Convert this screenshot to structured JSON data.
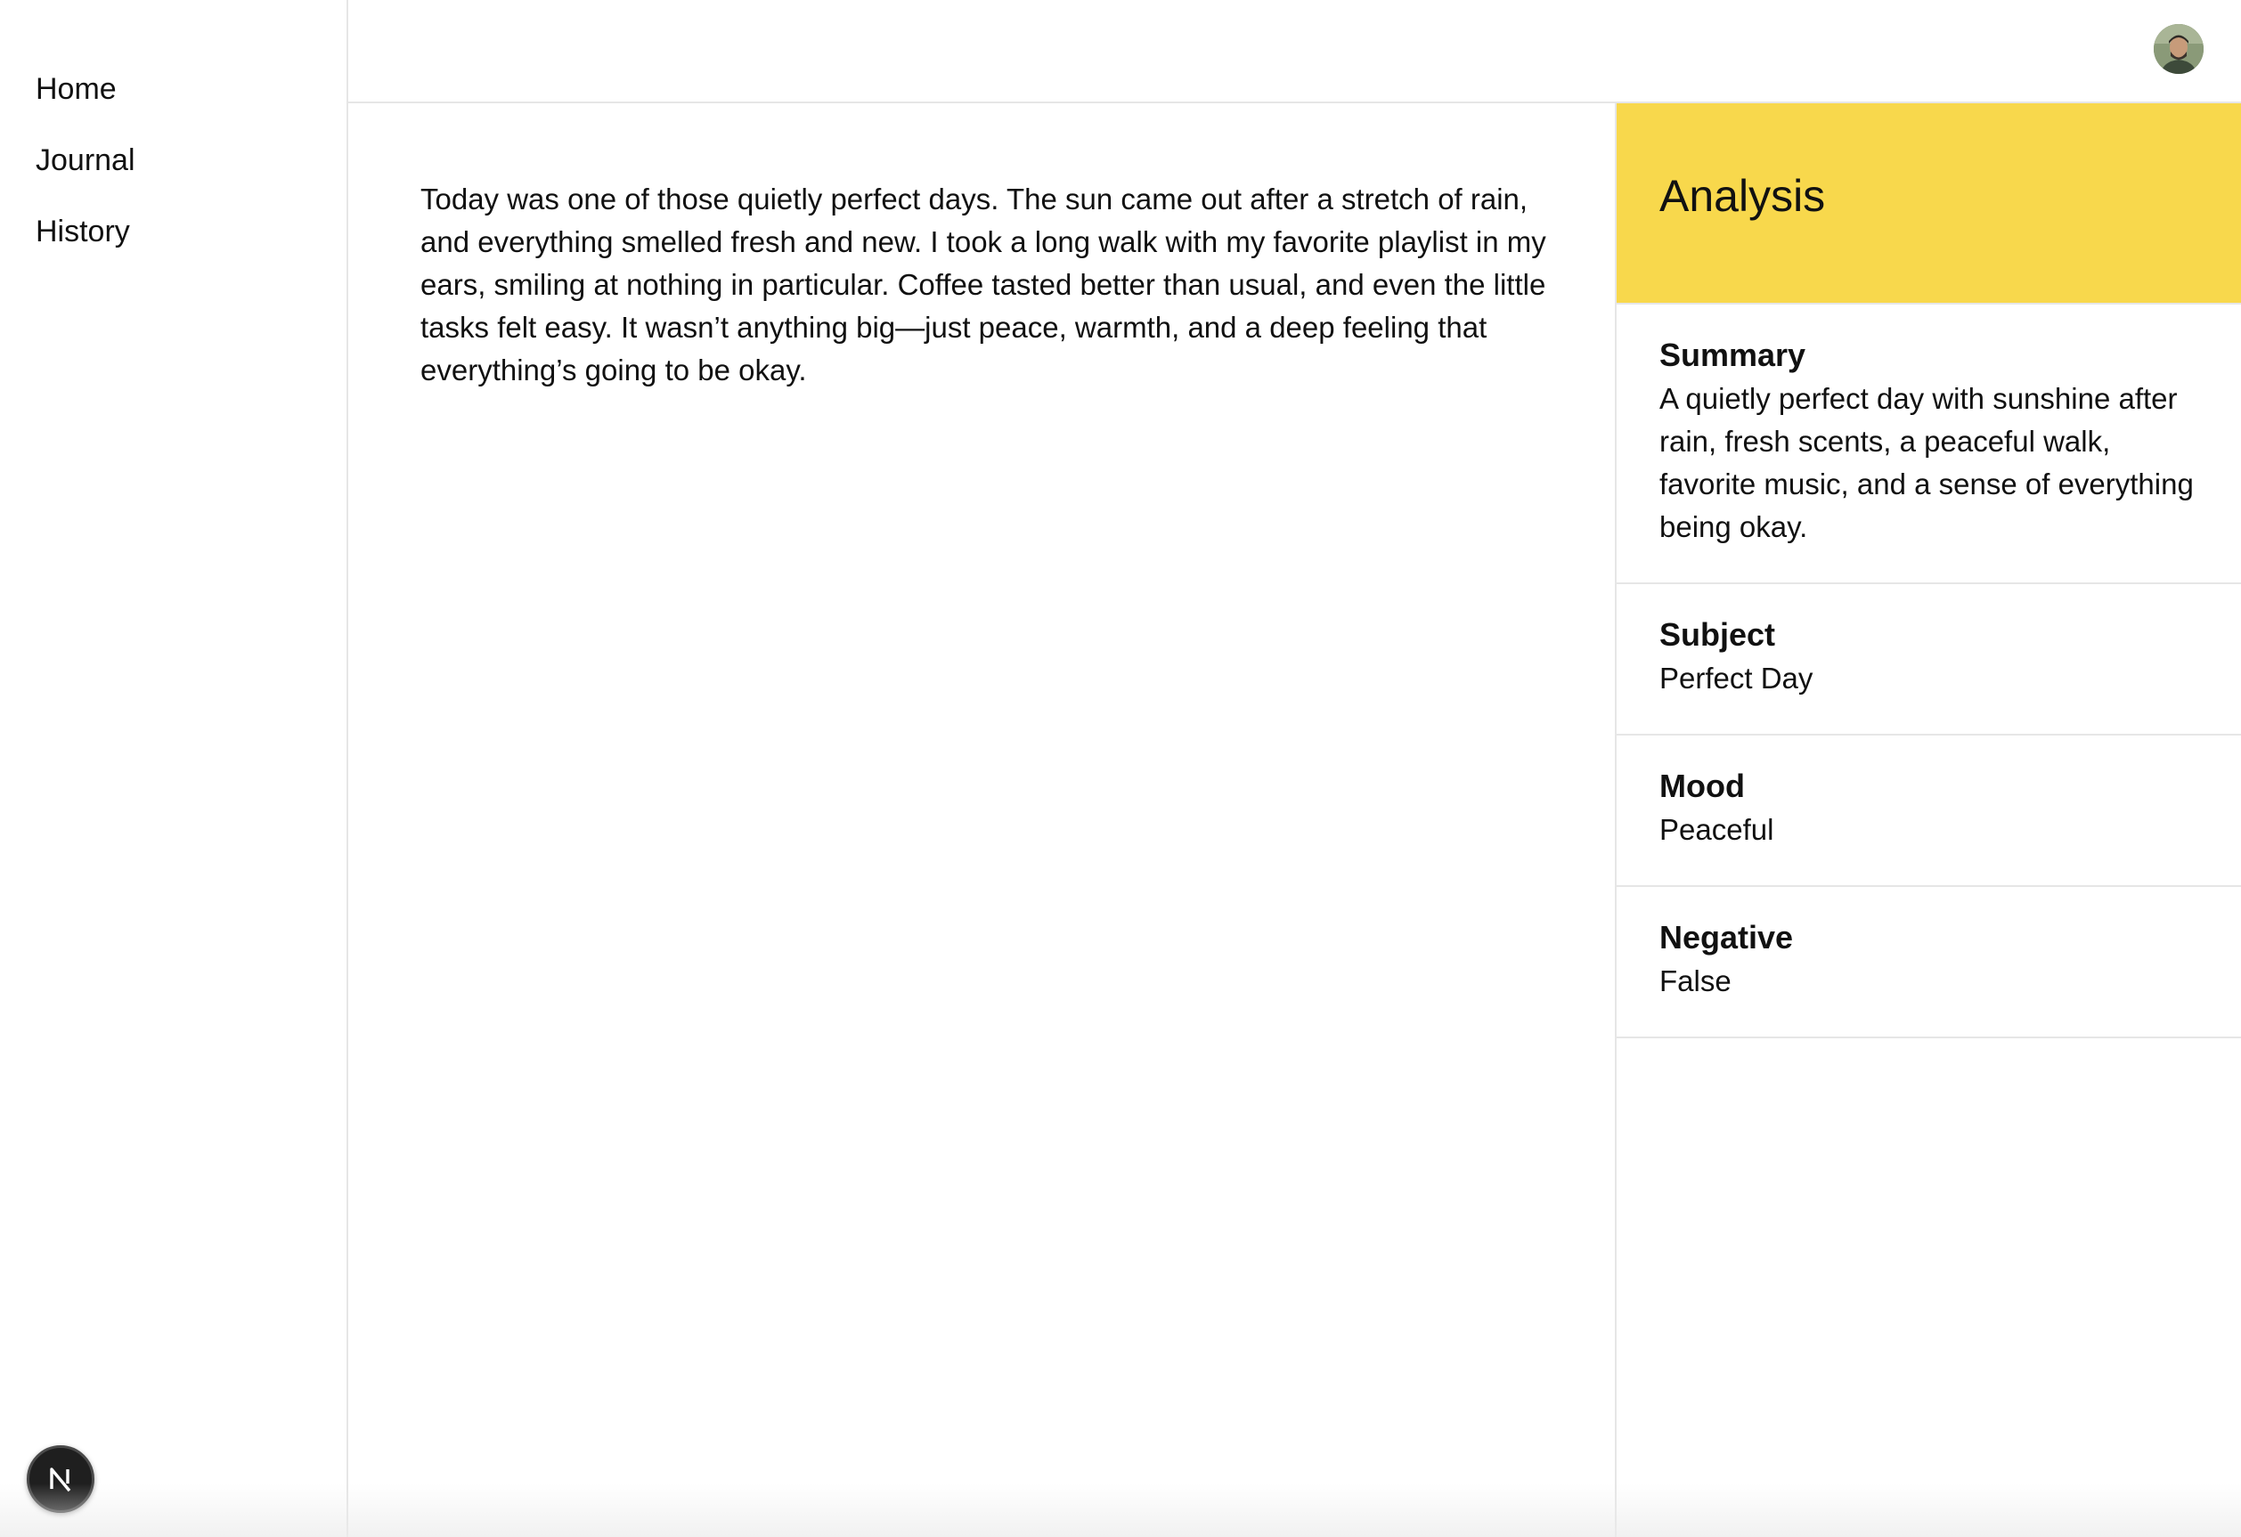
{
  "sidebar": {
    "items": [
      {
        "label": "Home"
      },
      {
        "label": "Journal"
      },
      {
        "label": "History"
      }
    ],
    "brand_icon": "nextjs-n-logo"
  },
  "topbar": {
    "avatar_icon": "user-avatar"
  },
  "editor": {
    "content": "Today was one of those quietly perfect days. The sun came out after a stretch of rain, and everything smelled fresh and new. I took a long walk with my favorite playlist in my ears, smiling at nothing in particular. Coffee tasted better than usual, and even the little tasks felt easy. It wasn’t anything big—just peace, warmth, and a deep feeling that everything’s going to be okay."
  },
  "analysis": {
    "title": "Analysis",
    "header_color": "#f8d84c",
    "items": [
      {
        "label": "Summary",
        "value": "A quietly perfect day with sunshine after rain, fresh scents, a peaceful walk, favorite music, and a sense of everything being okay."
      },
      {
        "label": "Subject",
        "value": "Perfect Day"
      },
      {
        "label": "Mood",
        "value": "Peaceful"
      },
      {
        "label": "Negative",
        "value": "False"
      }
    ]
  }
}
